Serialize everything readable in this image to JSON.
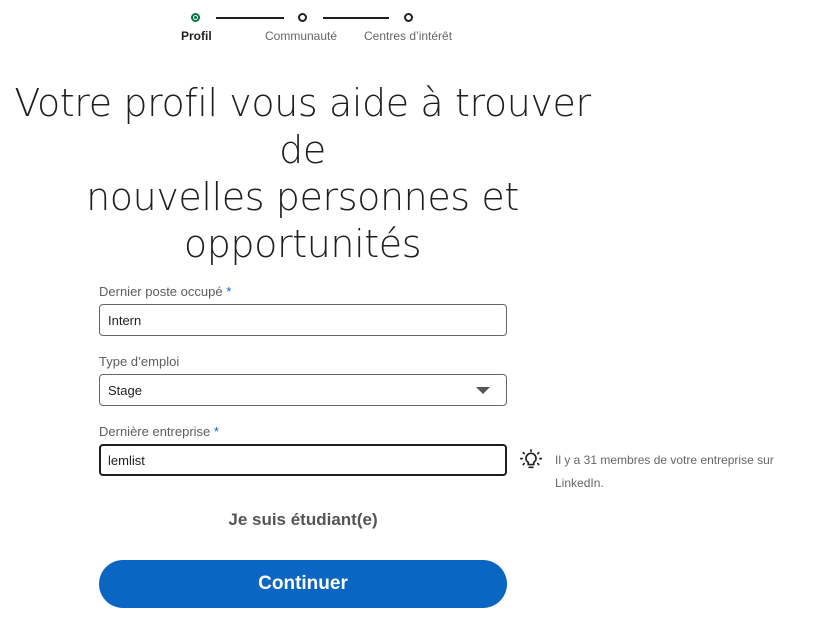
{
  "stepper": {
    "steps": [
      {
        "label": "Profil",
        "active": true
      },
      {
        "label": "Communauté",
        "active": false
      },
      {
        "label": "Centres d’intérêt",
        "active": false
      }
    ]
  },
  "headline": {
    "line1": "Votre profil vous aide à trouver de",
    "line2": "nouvelles personnes et",
    "line3": "opportunités"
  },
  "form": {
    "job_title": {
      "label": "Dernier poste occupé",
      "required_mark": "*",
      "value": "Intern"
    },
    "employment_type": {
      "label": "Type d’emploi",
      "selected": "Stage"
    },
    "company": {
      "label": "Dernière entreprise",
      "required_mark": "*",
      "value": "lemlist"
    },
    "hint": {
      "icon": "lightbulb-icon",
      "text": "Il y a 31 membres de votre entreprise sur LinkedIn."
    },
    "student_link": "Je suis étudiant(e)",
    "continue_label": "Continuer"
  },
  "colors": {
    "primary": "#0a66c2",
    "active_step": "#057642"
  }
}
